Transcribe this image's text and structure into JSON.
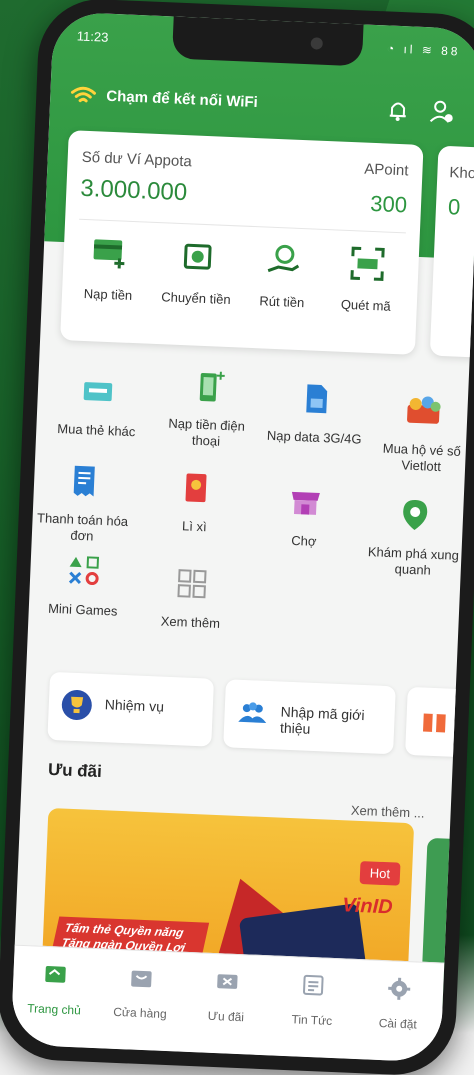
{
  "status": {
    "time": "11:23",
    "icons": "◔ ıl ≋ 88"
  },
  "header": {
    "wifi_text": "Chạm để kết nối WiFi",
    "wifi_icon": "wifi-icon",
    "bell_icon": "bell-icon",
    "user_icon": "user-icon"
  },
  "wallet": {
    "label": "Số dư Ví Appota",
    "balance": "3.000.000",
    "apoint_label": "APoint",
    "apoint_value": "300"
  },
  "side_card": {
    "label": "Kho",
    "value": "0"
  },
  "quick_actions": [
    {
      "label": "Nạp tiền",
      "icon": "deposit-icon"
    },
    {
      "label": "Chuyển tiền",
      "icon": "transfer-icon"
    },
    {
      "label": "Rút tiền",
      "icon": "withdraw-icon"
    },
    {
      "label": "Quét mã",
      "icon": "scan-icon"
    }
  ],
  "services": [
    {
      "label": "Mua thẻ khác",
      "icon": "card-icon"
    },
    {
      "label": "Nạp tiền điện thoại",
      "icon": "phone-topup-icon"
    },
    {
      "label": "Nạp data 3G/4G",
      "icon": "sim-data-icon"
    },
    {
      "label": "Mua hộ vé số Vietlott",
      "icon": "lottery-icon"
    },
    {
      "label": "Thanh toán hóa đơn",
      "icon": "bill-icon"
    },
    {
      "label": "Lì xì",
      "icon": "red-envelope-icon"
    },
    {
      "label": "Chợ",
      "icon": "market-icon"
    },
    {
      "label": "Khám phá xung quanh",
      "icon": "location-icon"
    },
    {
      "label": "Mini Games",
      "icon": "games-icon"
    },
    {
      "label": "Xem thêm",
      "icon": "grid-more-icon"
    }
  ],
  "promo_pills": [
    {
      "label": "Nhiệm vụ",
      "icon": "trophy-icon"
    },
    {
      "label": "Nhập mã giới thiệu",
      "icon": "referral-icon"
    }
  ],
  "offers": {
    "title": "Ưu đãi",
    "see_more": "Xem thêm ...",
    "hot": "Hot",
    "brand": "VinID",
    "tagline_1": "Tấm thẻ Quyền năng",
    "tagline_2": "Tăng ngàn Quyền Lợi"
  },
  "tabs": [
    {
      "label": "Trang chủ",
      "icon": "home-icon",
      "active": true
    },
    {
      "label": "Cửa hàng",
      "icon": "store-icon"
    },
    {
      "label": "Ưu đãi",
      "icon": "ticket-icon"
    },
    {
      "label": "Tin Tức",
      "icon": "news-icon"
    },
    {
      "label": "Cài đặt",
      "icon": "gear-icon"
    }
  ],
  "colors": {
    "primary": "#2d9640",
    "accent": "#e33e3e",
    "background": "#145a25"
  }
}
